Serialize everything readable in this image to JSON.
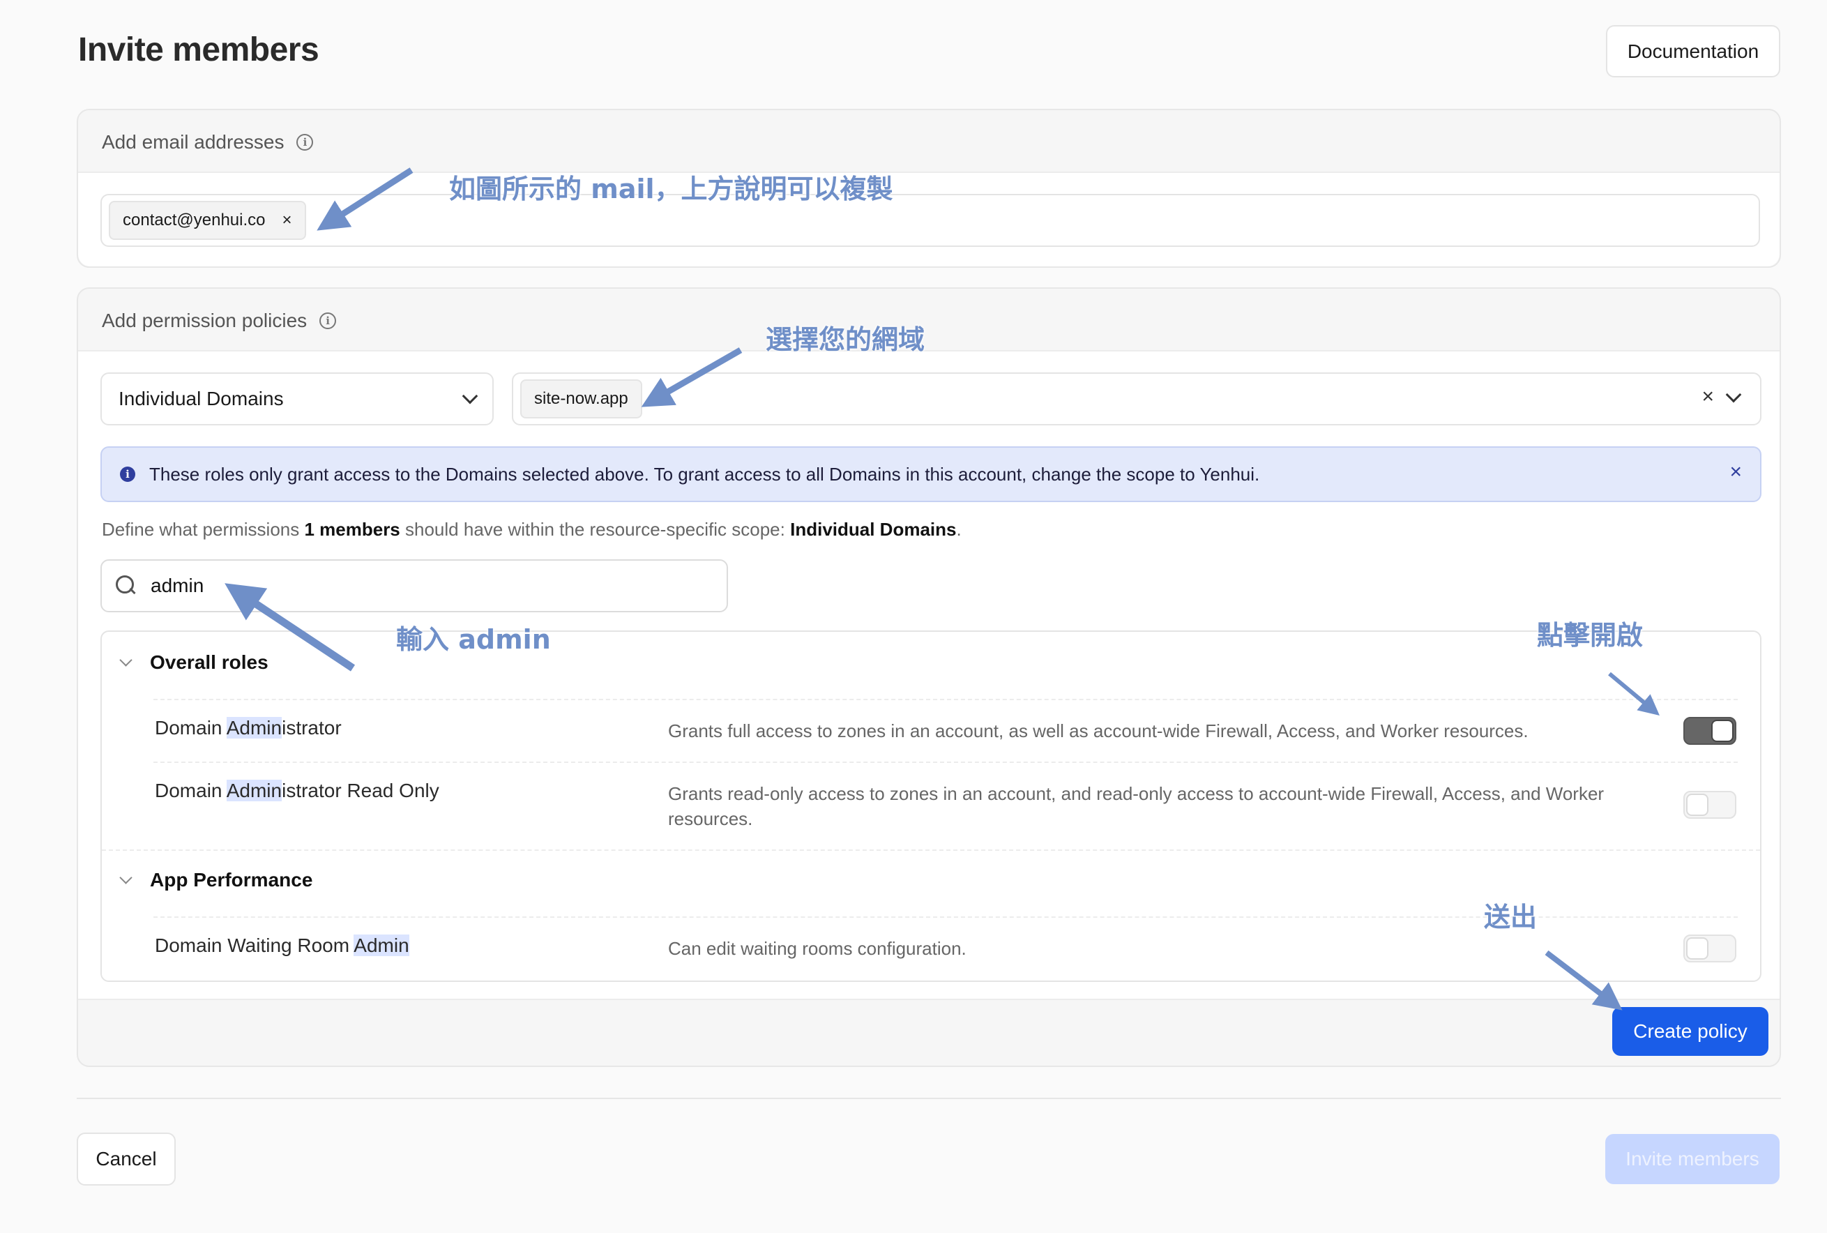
{
  "header": {
    "title": "Invite members",
    "documentation_label": "Documentation"
  },
  "email_section": {
    "label": "Add email addresses",
    "emails": [
      "contact@yenhui.co"
    ],
    "remove_glyph": "×"
  },
  "permission_section": {
    "label": "Add permission policies",
    "scope_select": {
      "value": "Individual Domains"
    },
    "domains": [
      "site-now.app"
    ],
    "clear_glyph": "×",
    "banner": {
      "text": "These roles only grant access to the Domains selected above. To grant access to all Domains in this account, change the scope to Yenhui.",
      "close_glyph": "×"
    },
    "define": {
      "prefix": "Define what permissions",
      "count": "1 members",
      "middle": "should have within the resource-specific scope:",
      "scope": "Individual Domains",
      "suffix": "."
    },
    "search": {
      "value": "admin"
    },
    "groups": [
      {
        "name": "Overall roles",
        "roles": [
          {
            "name_before": "Domain ",
            "name_match": "Admin",
            "name_after": "istrator",
            "description": "Grants full access to zones in an account, as well as account-wide Firewall, Access, and Worker resources.",
            "enabled": true
          },
          {
            "name_before": "Domain ",
            "name_match": "Admin",
            "name_after": "istrator Read Only",
            "description": "Grants read-only access to zones in an account, and read-only access to account-wide Firewall, Access, and Worker resources.",
            "enabled": false
          }
        ]
      },
      {
        "name": "App Performance",
        "roles": [
          {
            "name_before": "Domain Waiting Room ",
            "name_match": "Admin",
            "name_after": "",
            "description": "Can edit waiting rooms configuration.",
            "enabled": false
          }
        ]
      }
    ],
    "create_label": "Create policy"
  },
  "footer": {
    "cancel_label": "Cancel",
    "invite_label": "Invite members"
  },
  "annotations": {
    "email_note": "如圖所示的 mail，上方說明可以複製",
    "domain_note": "選擇您的網域",
    "search_note": "輸入 admin",
    "toggle_note": "點擊開啟",
    "submit_note": "送出"
  },
  "colors": {
    "primary": "#1a5de8",
    "annotation": "#6f8fc8",
    "banner_bg": "#e3e9fb",
    "disabled_button": "#c6d6ff"
  },
  "icons": [
    "info-icon",
    "close-icon",
    "chevron-down-icon",
    "search-icon",
    "arrow-icon"
  ]
}
